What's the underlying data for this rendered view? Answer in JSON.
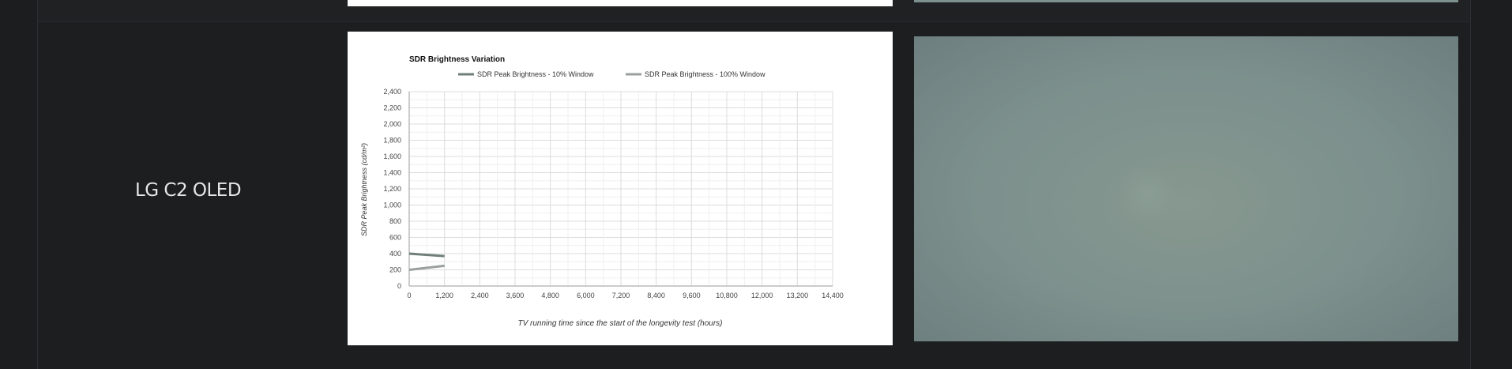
{
  "row": {
    "model_name": "LG C2 OLED"
  },
  "colors": {
    "page_bg": "#1b1d1f",
    "series_10pct": "#6f7f78",
    "series_100pct": "#9aa09c",
    "photo_tint": "#7e918d"
  },
  "chart_data": {
    "type": "line",
    "title": "SDR Brightness Variation",
    "xlabel": "TV running time since the start of the longevity test (hours)",
    "ylabel": "SDR Peak Brightness (cd/m²)",
    "xlim": [
      0,
      14400
    ],
    "ylim": [
      0,
      2400
    ],
    "x_ticks": [
      "0",
      "1,200",
      "2,400",
      "3,600",
      "4,800",
      "6,000",
      "7,200",
      "8,400",
      "9,600",
      "10,800",
      "12,000",
      "13,200",
      "14,400"
    ],
    "y_ticks": [
      "0",
      "200",
      "400",
      "600",
      "800",
      "1,000",
      "1,200",
      "1,400",
      "1,600",
      "1,800",
      "2,000",
      "2,200",
      "2,400"
    ],
    "grid": true,
    "legend_position": "top",
    "series": [
      {
        "name": "SDR Peak Brightness - 10% Window",
        "x": [
          0,
          1200
        ],
        "values": [
          400,
          370
        ]
      },
      {
        "name": "SDR Peak Brightness - 100% Window",
        "x": [
          0,
          1200
        ],
        "values": [
          200,
          250
        ]
      }
    ]
  }
}
